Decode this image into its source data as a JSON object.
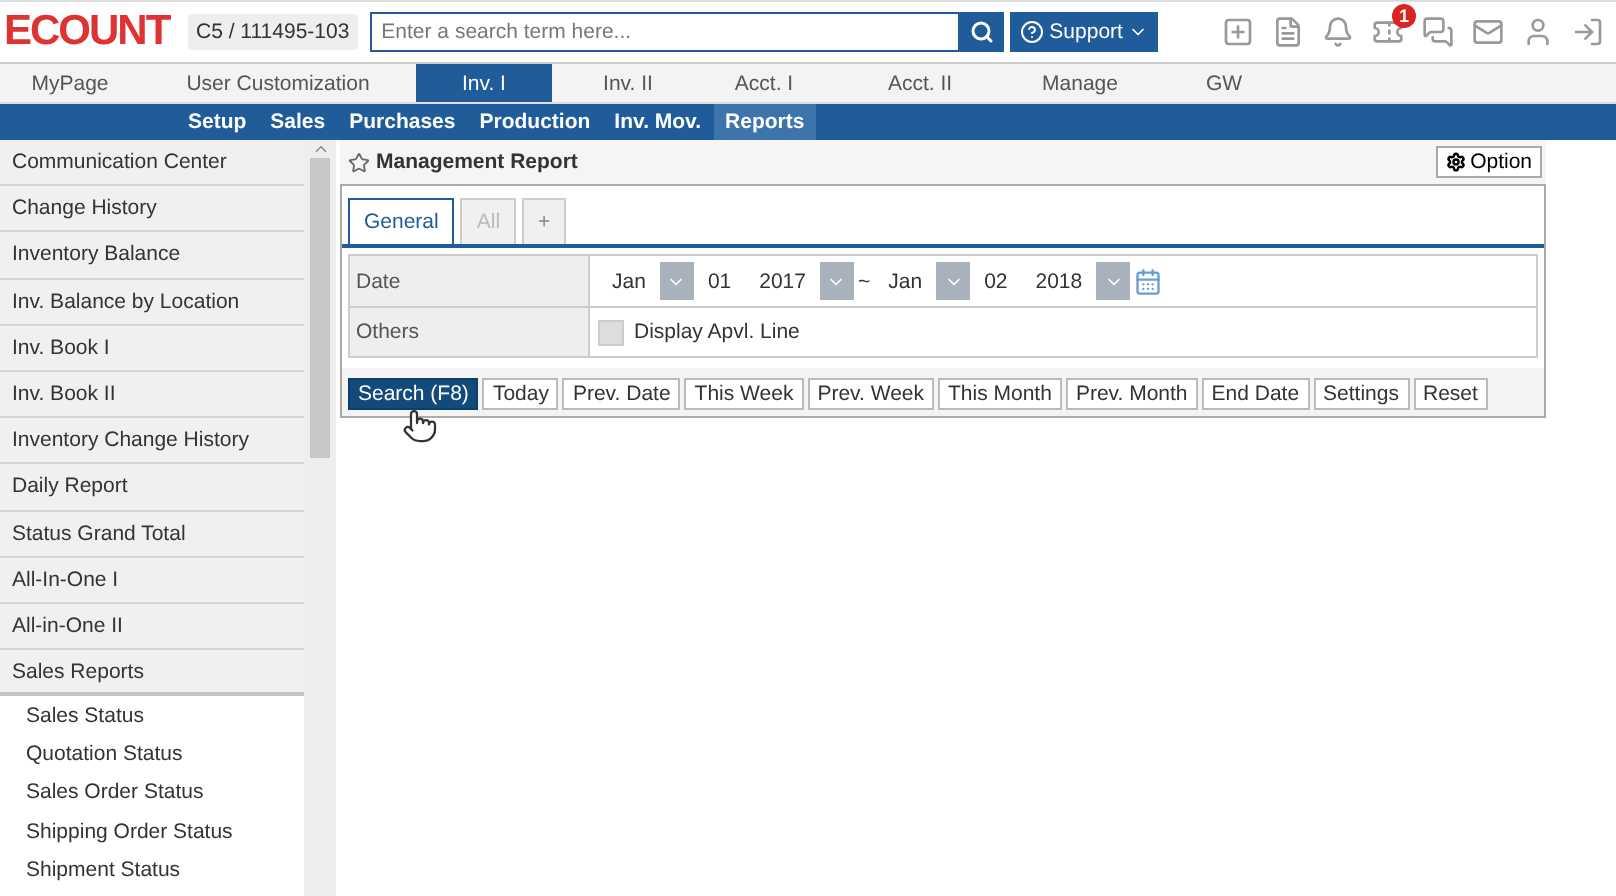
{
  "header": {
    "logo": "ECOUNT",
    "company": "C5 / 111495-103",
    "search": {
      "placeholder": "Enter a search term here..."
    },
    "support": "Support",
    "icons": [
      {
        "kind": "new-window"
      },
      {
        "kind": "document"
      },
      {
        "kind": "bell"
      },
      {
        "kind": "tag",
        "badge": "1"
      },
      {
        "kind": "chat"
      },
      {
        "kind": "mail"
      },
      {
        "kind": "user"
      },
      {
        "kind": "logout"
      }
    ]
  },
  "main_nav": [
    {
      "label": "MyPage",
      "selected": false
    },
    {
      "label": "User Customization",
      "selected": false
    },
    {
      "label": "Inv. I",
      "selected": true
    },
    {
      "label": "Inv. II",
      "selected": false
    },
    {
      "label": "Acct. I",
      "selected": false
    },
    {
      "label": "Acct. II",
      "selected": false
    },
    {
      "label": "Manage",
      "selected": false
    },
    {
      "label": "GW",
      "selected": false
    }
  ],
  "sub_nav": [
    {
      "label": "Setup",
      "selected": false
    },
    {
      "label": "Sales",
      "selected": false
    },
    {
      "label": "Purchases",
      "selected": false
    },
    {
      "label": "Production",
      "selected": false
    },
    {
      "label": "Inv. Mov.",
      "selected": false
    },
    {
      "label": "Reports",
      "selected": true
    }
  ],
  "sidebar": {
    "items": [
      {
        "label": "Communication Center"
      },
      {
        "label": "Change History"
      },
      {
        "label": "Inventory Balance"
      },
      {
        "label": "Inv. Balance by Location"
      },
      {
        "label": "Inv. Book I"
      },
      {
        "label": "Inv. Book II"
      },
      {
        "label": "Inventory Change History"
      },
      {
        "label": "Daily Report"
      },
      {
        "label": "Status Grand Total"
      },
      {
        "label": "All-In-One I"
      },
      {
        "label": "All-in-One II"
      },
      {
        "label": "Sales Reports",
        "expanded": true,
        "children": [
          {
            "label": "Sales Status"
          },
          {
            "label": "Quotation Status"
          },
          {
            "label": "Sales Order Status"
          },
          {
            "label": "Shipping Order Status"
          },
          {
            "label": "Shipment Status"
          }
        ]
      }
    ]
  },
  "report": {
    "title": "Management Report",
    "option": "Option",
    "tabs": [
      {
        "label": "General",
        "selected": true,
        "disabled": false
      },
      {
        "label": "All",
        "selected": false,
        "disabled": true
      },
      {
        "label": "+",
        "selected": false,
        "disabled": false
      }
    ],
    "date": {
      "label": "Date",
      "from": {
        "month": "Jan",
        "day": "01",
        "year": "2017"
      },
      "separator": "~",
      "to": {
        "month": "Jan",
        "day": "02",
        "year": "2018"
      }
    },
    "others": {
      "label": "Others",
      "checkbox": {
        "label": "Display Apvl. Line",
        "checked": false
      }
    },
    "buttons": [
      {
        "label": "Search (F8)",
        "primary": true
      },
      {
        "label": "Today",
        "primary": false
      },
      {
        "label": "Prev. Date",
        "primary": false
      },
      {
        "label": "This Week",
        "primary": false
      },
      {
        "label": "Prev. Week",
        "primary": false
      },
      {
        "label": "This Month",
        "primary": false
      },
      {
        "label": "Prev. Month",
        "primary": false
      },
      {
        "label": "End Date",
        "primary": false
      },
      {
        "label": "Settings",
        "primary": false
      },
      {
        "label": "Reset",
        "primary": false
      }
    ]
  }
}
